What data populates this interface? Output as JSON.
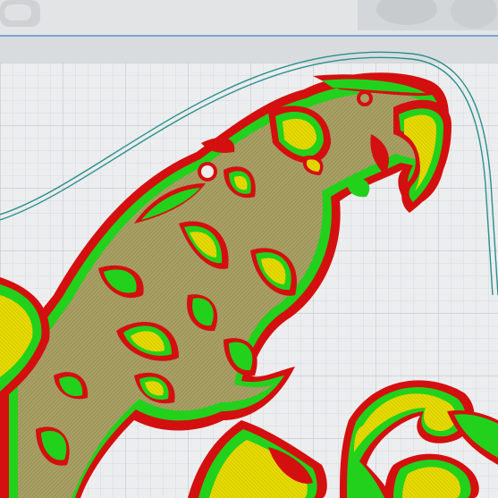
{
  "viewport": {
    "kind": "slicer-layer-preview",
    "colors": {
      "plate": "#ecedee",
      "grid_minor": "#d6d9dd",
      "grid_major": "#c3c7cc",
      "plate_edge_blue": "#5b8fd6",
      "outer_wall": "#d40f0f",
      "outer_wall_dark": "#8a0a0a",
      "inner_wall": "#22d11c",
      "infill_solid": "#e0d400",
      "infill_sparse": "#a8a064",
      "skirt": "#2a8f8f",
      "background_top": "#dcdfe2"
    },
    "icons": [
      "printer-housing-left-icon",
      "printer-housing-right-icon"
    ]
  }
}
